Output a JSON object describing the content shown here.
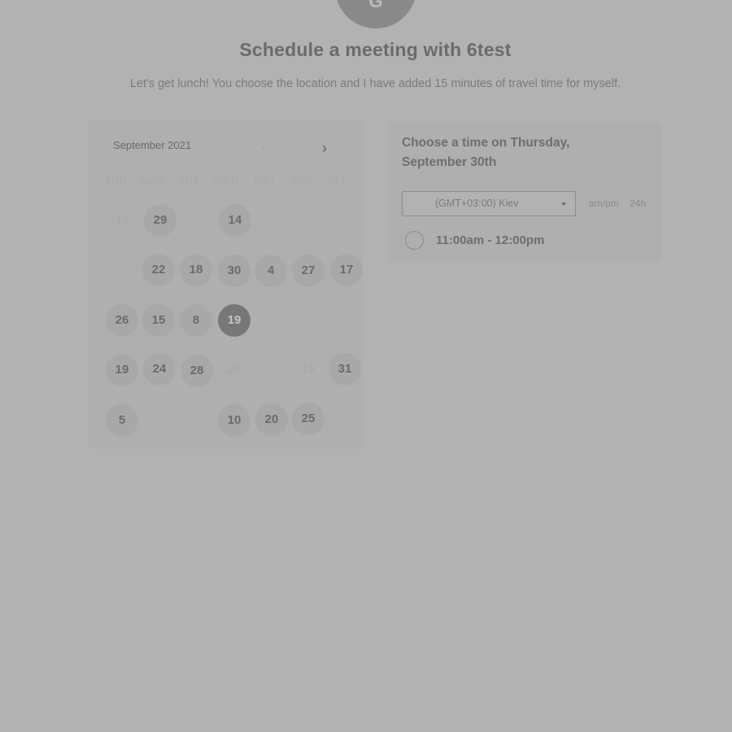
{
  "avatar": {
    "glyph": "G"
  },
  "header": {
    "title": "Schedule a meeting with 6test",
    "subtitle": "Let's get lunch! You choose the location and I have added 15 minutes of travel time for myself."
  },
  "calendar": {
    "month": "September 2021",
    "prev_icon": "chevron-left-icon",
    "next_icon": "chevron-right-icon",
    "weekdays": [
      "SUN",
      "MON",
      "TUE",
      "WED",
      "THU",
      "FRI",
      "SAT"
    ],
    "days": [
      {
        "label": "15",
        "state": "disabled"
      },
      {
        "label": "29",
        "state": "available"
      },
      {
        "label": "-",
        "state": "disabled"
      },
      {
        "label": "14",
        "state": "available"
      },
      {
        "label": "-",
        "state": "disabled"
      },
      {
        "label": "22",
        "state": "available"
      },
      {
        "label": "18",
        "state": "available"
      },
      {
        "label": "30",
        "state": "available"
      },
      {
        "label": "4",
        "state": "available"
      },
      {
        "label": "27",
        "state": "available"
      },
      {
        "label": "17",
        "state": "available"
      },
      {
        "label": "26",
        "state": "available"
      },
      {
        "label": "15",
        "state": "available"
      },
      {
        "label": "8",
        "state": "available"
      },
      {
        "label": "19",
        "state": "selected"
      },
      {
        "label": "19",
        "state": "available"
      },
      {
        "label": "24",
        "state": "available"
      },
      {
        "label": "28",
        "state": "available"
      },
      {
        "label": "28",
        "state": "disabled"
      },
      {
        "label": "19",
        "state": "disabled"
      },
      {
        "label": "31",
        "state": "available"
      },
      {
        "label": "5",
        "state": "available"
      },
      {
        "label": "10",
        "state": "available"
      },
      {
        "label": "20",
        "state": "available"
      },
      {
        "label": "25",
        "state": "available"
      }
    ]
  },
  "times": {
    "heading": "Choose a time on Thursday, September 30th",
    "timezone": "(GMT+03:00) Kiev",
    "format_12h": "am/pm",
    "format_24h": "24h",
    "slots": [
      {
        "label": "11:00am - 12:00pm"
      }
    ]
  },
  "colors": {
    "background": "#b2b2b2",
    "selected_day": "#777777",
    "available_day": "#a8a8a8"
  }
}
